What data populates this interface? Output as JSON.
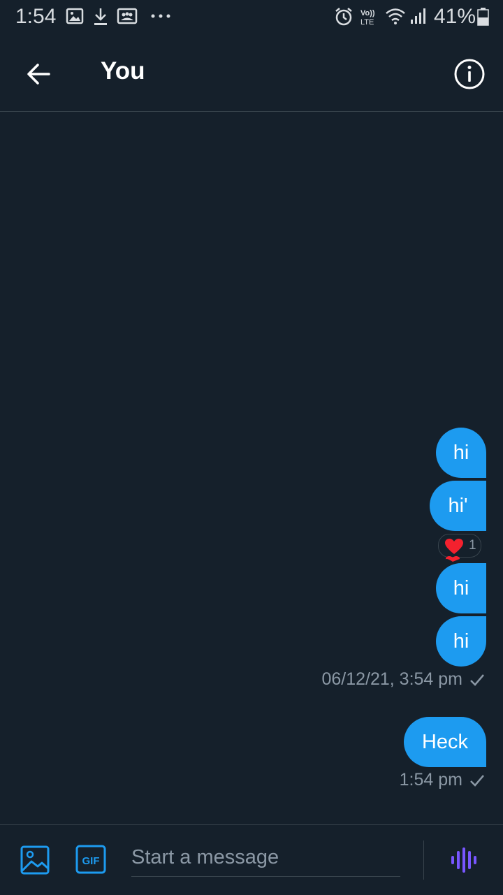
{
  "status_bar": {
    "time": "1:54",
    "battery": "41%",
    "icons": [
      "image-icon",
      "download-icon",
      "people-icon",
      "more-dots-icon",
      "alarm-icon",
      "volte-icon",
      "wifi-icon",
      "signal-icon",
      "battery-icon"
    ]
  },
  "header": {
    "title": "You"
  },
  "messages": [
    {
      "text": "hi"
    },
    {
      "text": "hi'",
      "reaction": {
        "emoji": "heart",
        "count": "1"
      }
    },
    {
      "text": "hi"
    },
    {
      "text": "hi",
      "timestamp": "06/12/21, 3:54 pm"
    },
    {
      "text": "Heck",
      "timestamp": "1:54 pm"
    }
  ],
  "composer": {
    "placeholder": "Start a message",
    "gif_label": "GIF"
  },
  "colors": {
    "background": "#15202b",
    "bubble": "#1d9bf0",
    "muted": "#8b98a5",
    "voice": "#7856ff",
    "heart": "#f91880"
  }
}
